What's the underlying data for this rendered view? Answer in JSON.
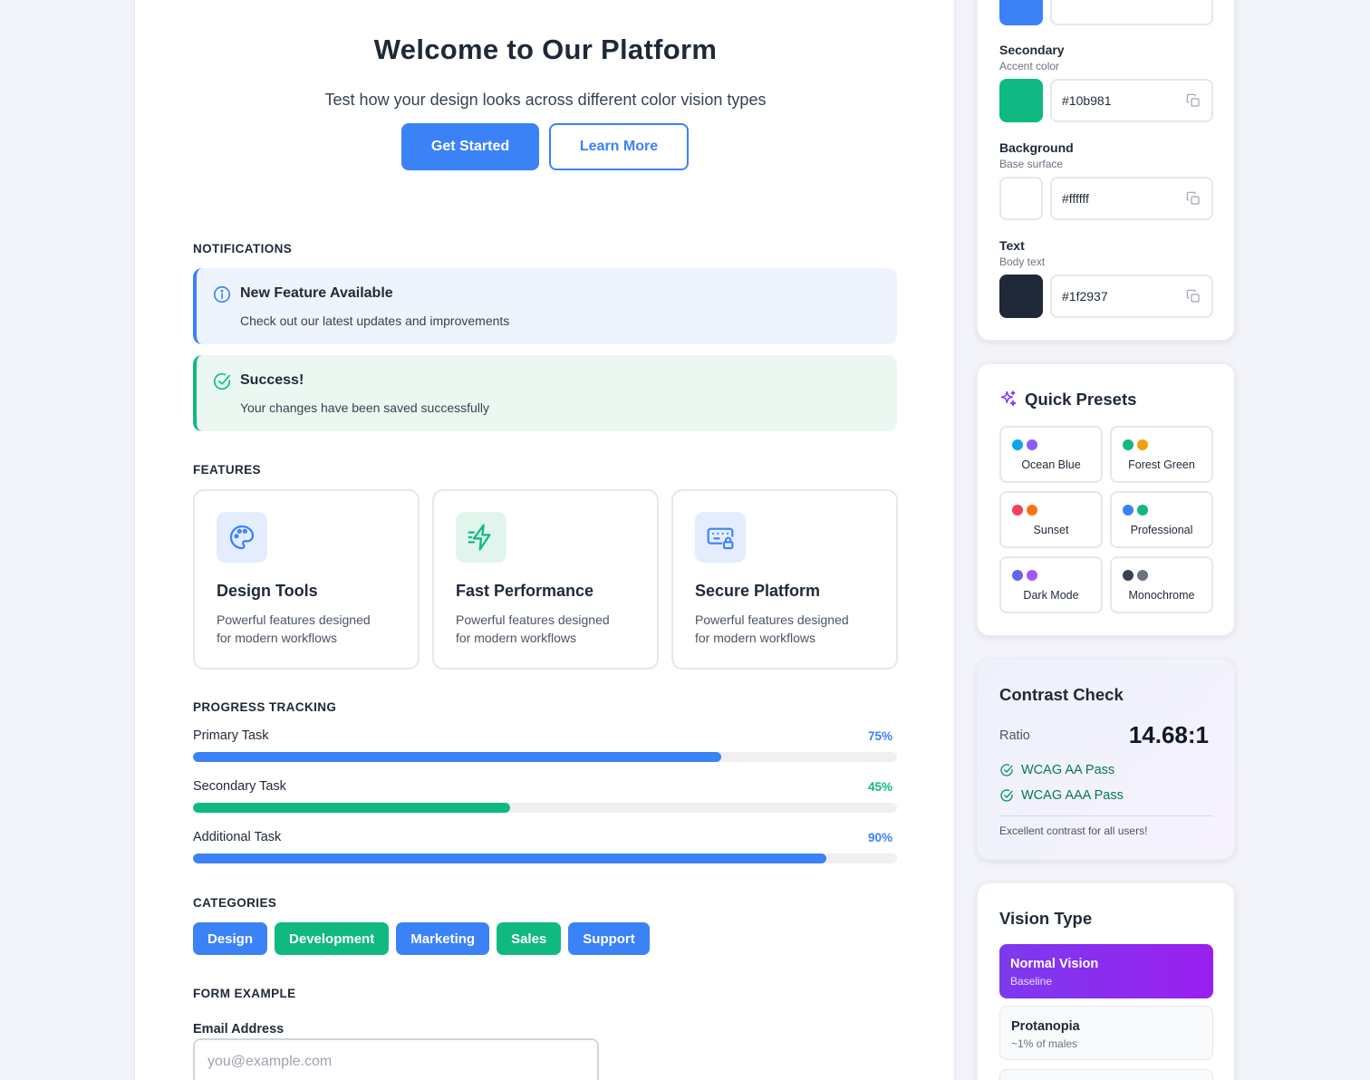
{
  "hero": {
    "title": "Welcome to Our Platform",
    "subtitle": "Test how your design looks across different color vision types",
    "primary_button": "Get Started",
    "secondary_button": "Learn More"
  },
  "notifications": {
    "heading": "NOTIFICATIONS",
    "items": [
      {
        "title": "New Feature Available",
        "body": "Check out our latest updates and improvements",
        "icon": "info-icon",
        "color": "#3b82f6"
      },
      {
        "title": "Success!",
        "body": "Your changes have been saved successfully",
        "icon": "check-circle-icon",
        "color": "#10b981"
      }
    ]
  },
  "features": {
    "heading": "FEATURES",
    "items": [
      {
        "title": "Design Tools",
        "desc": "Powerful features designed for modern workflows",
        "icon": "palette-icon"
      },
      {
        "title": "Fast Performance",
        "desc": "Powerful features designed for modern workflows",
        "icon": "lightning-icon"
      },
      {
        "title": "Secure Platform",
        "desc": "Powerful features designed for modern workflows",
        "icon": "secure-keyboard-lock-icon"
      }
    ]
  },
  "progress": {
    "heading": "PROGRESS TRACKING",
    "items": [
      {
        "label": "Primary Task",
        "value": "75%",
        "fraction": 0.75,
        "color": "#3b82f6"
      },
      {
        "label": "Secondary Task",
        "value": "45%",
        "fraction": 0.45,
        "color": "#10b981"
      },
      {
        "label": "Additional Task",
        "value": "90%",
        "fraction": 0.9,
        "color": "#3b82f6"
      }
    ]
  },
  "categories": {
    "heading": "CATEGORIES",
    "tags": [
      {
        "label": "Design",
        "color": "#3b82f6"
      },
      {
        "label": "Development",
        "color": "#10b981"
      },
      {
        "label": "Marketing",
        "color": "#3b82f6"
      },
      {
        "label": "Sales",
        "color": "#10b981"
      },
      {
        "label": "Support",
        "color": "#3b82f6"
      }
    ]
  },
  "form": {
    "heading": "FORM EXAMPLE",
    "email_label": "Email Address",
    "email_placeholder": "you@example.com"
  },
  "palette": {
    "primary_hex": "#3b82f6",
    "colors": [
      {
        "name": "Secondary",
        "sub": "Accent color",
        "hex": "#10b981"
      },
      {
        "name": "Background",
        "sub": "Base surface",
        "hex": "#ffffff"
      },
      {
        "name": "Text",
        "sub": "Body text",
        "hex": "#1f2937"
      }
    ]
  },
  "presets": {
    "title": "Quick Presets",
    "items": [
      {
        "name": "Ocean Blue",
        "colors": [
          "#0ea5e9",
          "#8b5cf6"
        ]
      },
      {
        "name": "Forest Green",
        "colors": [
          "#10b981",
          "#f59e0b"
        ]
      },
      {
        "name": "Sunset",
        "colors": [
          "#f43f5e",
          "#f97316"
        ]
      },
      {
        "name": "Professional",
        "colors": [
          "#3b82f6",
          "#10b981"
        ]
      },
      {
        "name": "Dark Mode",
        "colors": [
          "#6366f1",
          "#a855f7"
        ]
      },
      {
        "name": "Monochrome",
        "colors": [
          "#374151",
          "#6b7280"
        ]
      }
    ]
  },
  "contrast": {
    "title": "Contrast Check",
    "ratio_label": "Ratio",
    "ratio": "14.68:1",
    "checks": [
      "WCAG AA Pass",
      "WCAG AAA Pass"
    ],
    "note": "Excellent contrast for all users!"
  },
  "vision": {
    "title": "Vision Type",
    "items": [
      {
        "name": "Normal Vision",
        "sub": "Baseline",
        "selected": true
      },
      {
        "name": "Protanopia",
        "sub": "~1% of males",
        "selected": false
      }
    ]
  }
}
